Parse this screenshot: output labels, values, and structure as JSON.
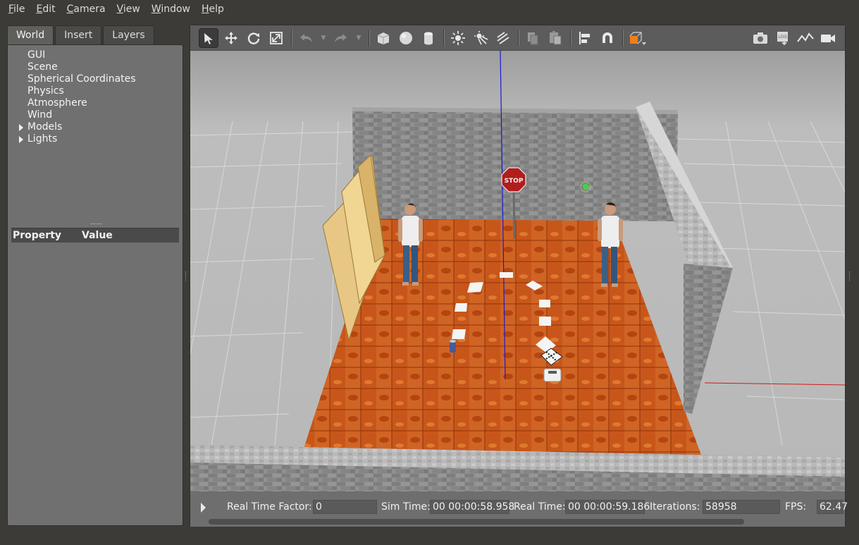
{
  "menu": [
    {
      "u": "F",
      "rest": "ile"
    },
    {
      "u": "E",
      "rest": "dit"
    },
    {
      "u": "C",
      "rest": "amera"
    },
    {
      "u": "V",
      "rest": "iew"
    },
    {
      "u": "W",
      "rest": "indow"
    },
    {
      "u": "H",
      "rest": "elp"
    }
  ],
  "tabs": {
    "world": "World",
    "insert": "Insert",
    "layers": "Layers"
  },
  "tree": {
    "gui": "GUI",
    "scene": "Scene",
    "spherical": "Spherical Coordinates",
    "physics": "Physics",
    "atmosphere": "Atmosphere",
    "wind": "Wind",
    "models": "Models",
    "lights": "Lights"
  },
  "properties": {
    "property_header": "Property",
    "value_header": "Value"
  },
  "toolbar": {
    "tools": [
      "select-arrow",
      "translate",
      "rotate",
      "scale",
      "undo",
      "redo",
      "box",
      "sphere",
      "cylinder",
      "point-light",
      "spot-light",
      "directional-light",
      "copy",
      "paste",
      "align",
      "snap",
      "view-angle"
    ],
    "right_tools": [
      "screenshot",
      "log",
      "plot",
      "record-video"
    ]
  },
  "scene": {
    "stop_sign_text": "STOP"
  },
  "status": {
    "real_time_factor_label": "Real Time Factor:",
    "real_time_factor": "0",
    "sim_time_label": "Sim Time:",
    "sim_time": "00 00:00:58.958",
    "real_time_label": "Real Time:",
    "real_time": "00 00:00:59.186",
    "iterations_label": "Iterations:",
    "iterations": "58958",
    "fps_label": "FPS:",
    "fps": "62.47"
  },
  "colors": {
    "floor": "#c8561b",
    "wall": "#8a8a8a",
    "ground": "#bdbdbd",
    "accent_orange": "#f07d1a"
  }
}
